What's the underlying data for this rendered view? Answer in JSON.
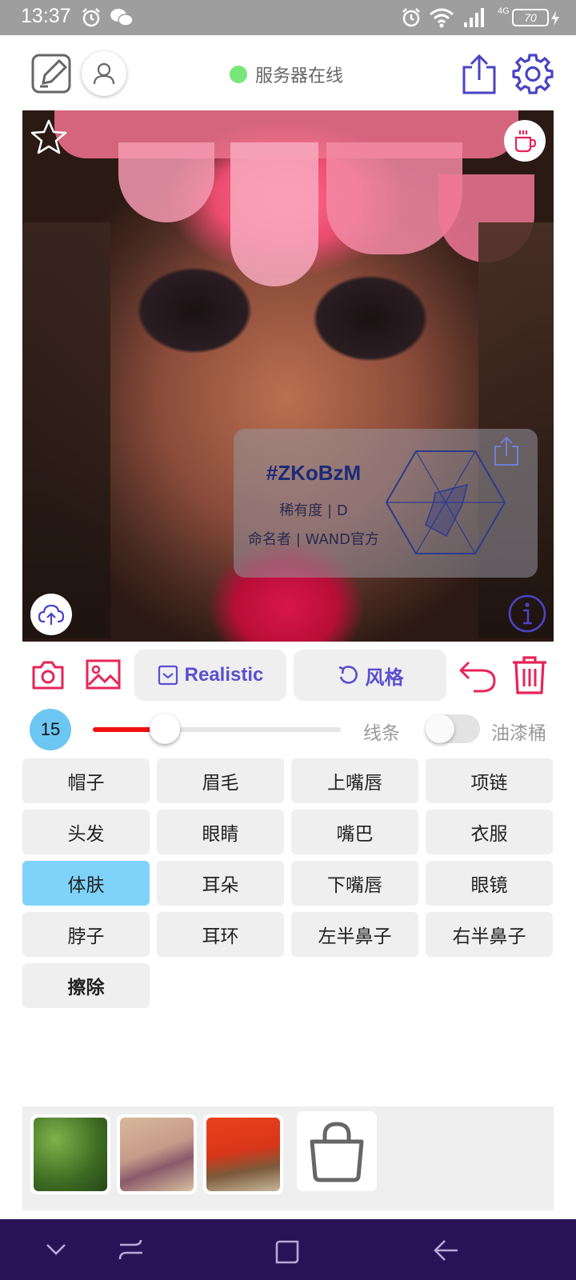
{
  "status_bar": {
    "time": "13:37",
    "network": "4G",
    "battery": "70"
  },
  "header": {
    "server_status": "服务器在线"
  },
  "colors": {
    "accent": "#5b4fd0",
    "pink": "#e8245a",
    "selected": "#7fd3fb",
    "online": "#77e77a",
    "nav": "#2a1257"
  },
  "card": {
    "id": "#ZKoBzM",
    "rarity": "稀有度 | D",
    "namer": "命名者 | WAND官方"
  },
  "toolbar": {
    "model_label": "Realistic",
    "style_label": "风格"
  },
  "brush": {
    "size": "15",
    "line_label": "线条",
    "bucket_label": "油漆桶",
    "slider_percent": 29,
    "bucket_on": false
  },
  "parts": [
    [
      "帽子",
      "眉毛",
      "上嘴唇",
      "项链"
    ],
    [
      "头发",
      "眼睛",
      "嘴巴",
      "衣服"
    ],
    [
      "体肤",
      "耳朵",
      "下嘴唇",
      "眼镜"
    ],
    [
      "脖子",
      "耳环",
      "左半鼻子",
      "右半鼻子"
    ],
    [
      "擦除"
    ]
  ],
  "selected_part": "体肤",
  "icons": [
    "alarm-icon",
    "wechat-icon",
    "wifi-icon",
    "signal-icon",
    "edit-icon",
    "user-icon",
    "share-icon",
    "gear-icon",
    "star-icon",
    "coffee-cup-icon",
    "cloud-upload-icon",
    "info-icon",
    "camera-icon",
    "image-icon",
    "check-box-icon",
    "refresh-icon",
    "undo-icon",
    "trash-icon",
    "shopping-bag-icon"
  ]
}
